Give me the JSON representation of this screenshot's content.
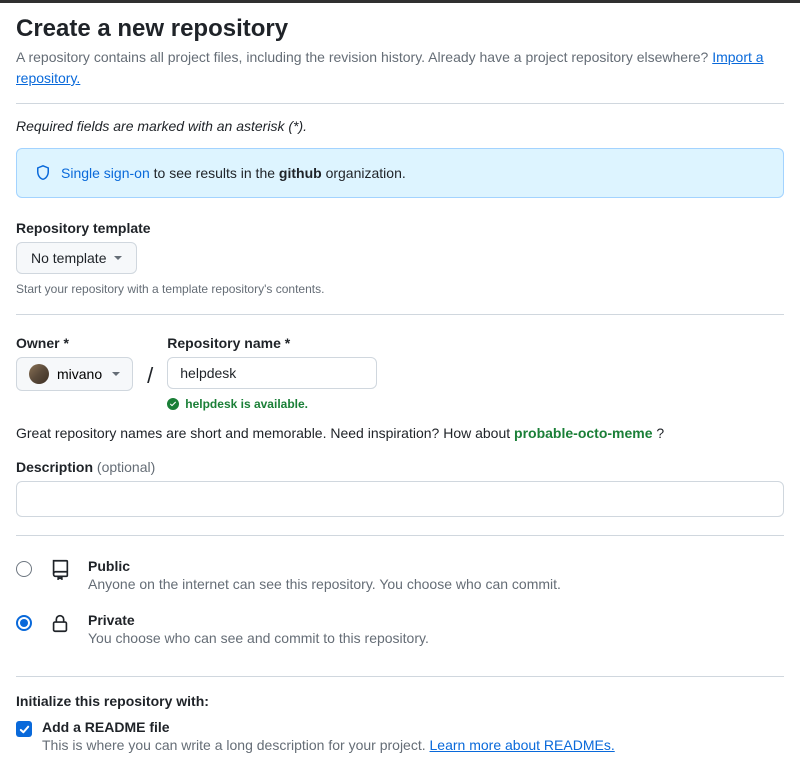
{
  "header": {
    "title": "Create a new repository",
    "subhead_text": "A repository contains all project files, including the revision history. Already have a project repository elsewhere? ",
    "import_link": "Import a repository."
  },
  "required_note": "Required fields are marked with an asterisk (*).",
  "sso": {
    "link_text": "Single sign-on",
    "rest_before": " to see results in the ",
    "org": "github",
    "rest_after": " organization."
  },
  "template": {
    "label": "Repository template",
    "button": "No template",
    "hint": "Start your repository with a template repository's contents."
  },
  "owner": {
    "label": "Owner *",
    "name": "mivano"
  },
  "repo": {
    "label": "Repository name *",
    "value": "helpdesk",
    "availability": "helpdesk is available."
  },
  "inspiration": {
    "text_before": "Great repository names are short and memorable. Need inspiration? How about ",
    "suggestion": "probable-octo-meme",
    "text_after": " ?"
  },
  "description": {
    "label": "Description ",
    "optional": "(optional)",
    "value": ""
  },
  "visibility": {
    "public": {
      "title": "Public",
      "desc": "Anyone on the internet can see this repository. You choose who can commit."
    },
    "private": {
      "title": "Private",
      "desc": "You choose who can see and commit to this repository."
    }
  },
  "initialize": {
    "title": "Initialize this repository with:",
    "readme": {
      "title": "Add a README file",
      "desc_before": "This is where you can write a long description for your project. ",
      "link": "Learn more about READMEs."
    }
  }
}
